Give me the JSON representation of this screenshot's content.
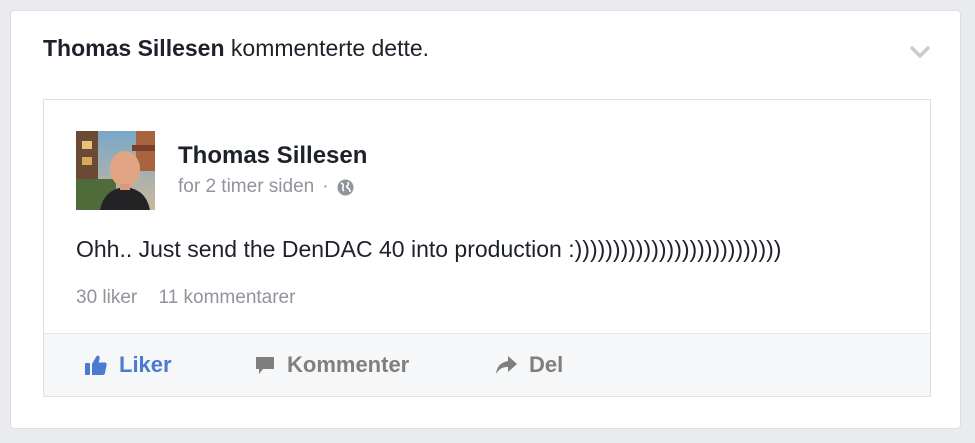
{
  "story": {
    "actor": "Thomas Sillesen",
    "action_text": "kommenterte dette."
  },
  "post": {
    "author": "Thomas Sillesen",
    "time": "for 2 timer siden",
    "separator": "·",
    "privacy_icon": "globe-icon",
    "text": "Ohh.. Just send the DenDAC 40 into production :)))))))))))))))))))))))))))",
    "likes": "30 liker",
    "comments": "11 kommentarer"
  },
  "actions": {
    "like_label": "Liker",
    "like_icon": "thumbs-up-icon",
    "comment_label": "Kommenter",
    "comment_icon": "speech-bubble-icon",
    "share_label": "Del",
    "share_icon": "share-arrow-icon"
  },
  "colors": {
    "background": "#e9ebee",
    "card": "#ffffff",
    "text": "#1d2129",
    "muted": "#90949c",
    "like_active": "#4b7bd1",
    "action_gray": "#7f7f7f"
  }
}
